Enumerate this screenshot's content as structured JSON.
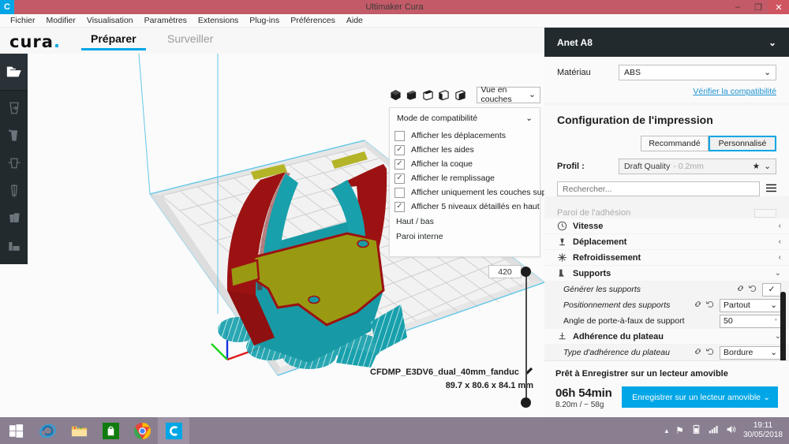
{
  "window": {
    "title": "Ultimaker Cura",
    "app_badge": "C",
    "minimize": "–",
    "maximize": "❐",
    "close": "✕",
    "titlebar_color": "#c25b67",
    "accent_color": "#00a6e6"
  },
  "menubar": {
    "items": [
      {
        "label": "Fichier"
      },
      {
        "label": "Modifier"
      },
      {
        "label": "Visualisation"
      },
      {
        "label": "Paramètres"
      },
      {
        "label": "Extensions"
      },
      {
        "label": "Plug-ins"
      },
      {
        "label": "Préférences"
      },
      {
        "label": "Aide"
      }
    ]
  },
  "header": {
    "logo": "cura",
    "logo_dot": ".",
    "tabs": [
      {
        "label": "Préparer",
        "active": true
      },
      {
        "label": "Surveiller",
        "active": false
      }
    ]
  },
  "left_toolbar": {
    "open_icon": "open-folder-icon",
    "tools": [
      {
        "name": "move-tool-icon"
      },
      {
        "name": "scale-tool-icon"
      },
      {
        "name": "rotate-tool-icon"
      },
      {
        "name": "mirror-tool-icon"
      },
      {
        "name": "per-model-settings-tool-icon"
      },
      {
        "name": "support-blocker-tool-icon"
      }
    ]
  },
  "viewport": {
    "view_buttons": [
      {
        "name": "view-3d-icon"
      },
      {
        "name": "view-front-icon"
      },
      {
        "name": "view-top-icon"
      },
      {
        "name": "view-left-icon"
      },
      {
        "name": "view-right-icon"
      }
    ],
    "view_mode": "Vue en couches",
    "layer_panel": {
      "compatibility_mode": "Mode de compatibilité",
      "options": [
        {
          "label": "Afficher les déplacements",
          "checked": false
        },
        {
          "label": "Afficher les aides",
          "checked": true
        },
        {
          "label": "Afficher la coque",
          "checked": true
        },
        {
          "label": "Afficher le remplissage",
          "checked": true
        },
        {
          "label": "Afficher uniquement les couches supérieures",
          "checked": false
        },
        {
          "label": "Afficher 5 niveaux détaillés en haut",
          "checked": true
        }
      ],
      "extra_rows": [
        {
          "label": "Haut / bas"
        },
        {
          "label": "Paroi interne"
        }
      ]
    },
    "layer_slider": {
      "value": "420"
    },
    "model_name": "CFDMP_E3DV6_dual_40mm_fanduc",
    "model_dims": "89.7 x 80.6 x 84.1 mm",
    "edit_icon": "pencil-icon"
  },
  "sidebar": {
    "printer": {
      "name": "Anet A8",
      "chevron": "⌄"
    },
    "material": {
      "label": "Matériau",
      "value": "ABS",
      "compat_link": "Vérifier la compatibilité"
    },
    "config": {
      "title": "Configuration de l'impression",
      "modes": [
        {
          "label": "Recommandé",
          "active": false
        },
        {
          "label": "Personnalisé",
          "active": true
        }
      ],
      "profile_label": "Profil :",
      "profile_value": "Draft Quality",
      "profile_sub": "- 0.2mm",
      "profile_star": "★",
      "search_placeholder": "Rechercher...",
      "menu_icon": "hamburger-icon"
    },
    "settings": {
      "clipped_label": "Paroi de l'adhésion",
      "categories": [
        {
          "icon": "speed-icon",
          "label": "Vitesse",
          "expanded": false
        },
        {
          "icon": "travel-icon",
          "label": "Déplacement",
          "expanded": false
        },
        {
          "icon": "cooling-icon",
          "label": "Refroidissement",
          "expanded": false
        },
        {
          "icon": "support-icon",
          "label": "Supports",
          "expanded": true
        }
      ],
      "support_rows": [
        {
          "label": "Générer les supports",
          "type": "check",
          "value": "✓",
          "italic": true,
          "has_icons": true
        },
        {
          "label": "Positionnement des supports",
          "type": "select",
          "value": "Partout",
          "italic": true,
          "has_icons": true
        },
        {
          "label": "Angle de porte-à-faux de support",
          "type": "number",
          "value": "50",
          "unit": "°",
          "italic": false,
          "has_icons": false
        }
      ],
      "adhesion_category": {
        "icon": "adhesion-icon",
        "label": "Adhérence du plateau",
        "expanded": true
      },
      "adhesion_rows": [
        {
          "label": "Type d'adhérence du plateau",
          "type": "select",
          "value": "Bordure",
          "italic": true,
          "has_icons": true
        }
      ]
    },
    "action": {
      "ready_text": "Prêt à Enregistrer sur un lecteur amovible",
      "time": "06h 54min",
      "usage": "8.20m / ~ 58g",
      "save_label": "Enregistrer sur un lecteur amovible",
      "save_chevron": "⌄"
    }
  },
  "taskbar": {
    "items": [
      {
        "name": "start-button-icon"
      },
      {
        "name": "internet-explorer-icon"
      },
      {
        "name": "file-explorer-icon"
      },
      {
        "name": "windows-store-icon"
      },
      {
        "name": "google-chrome-icon"
      },
      {
        "name": "cura-taskbar-icon",
        "active": true
      }
    ],
    "tray": [
      {
        "name": "show-hidden-icons-icon",
        "glyph": "▴"
      },
      {
        "name": "action-center-icon",
        "glyph": "⚑"
      },
      {
        "name": "battery-icon",
        "glyph": "▮"
      },
      {
        "name": "network-icon",
        "glyph": "◥"
      },
      {
        "name": "volume-icon",
        "glyph": "🔊"
      }
    ],
    "time": "19:11",
    "date": "30/05/2018"
  }
}
